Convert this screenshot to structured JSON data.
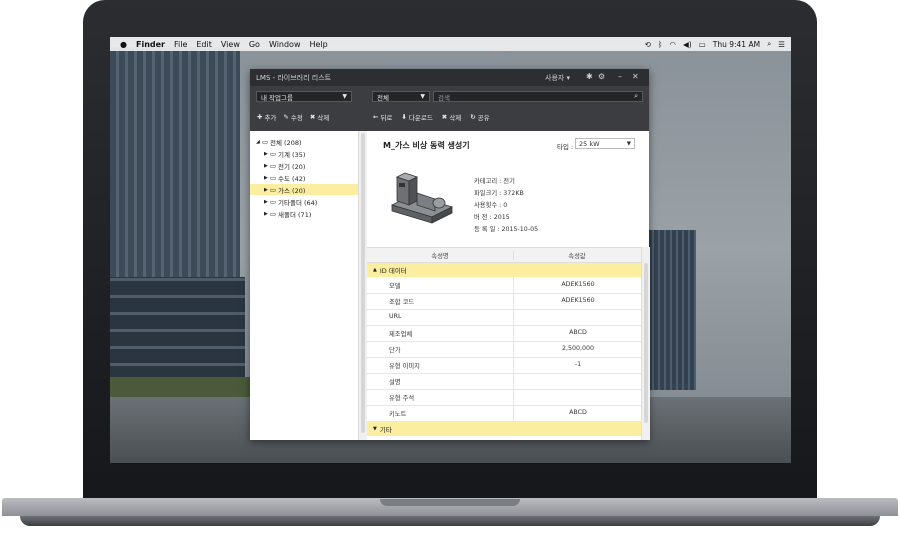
{
  "menubar": {
    "apple": "",
    "app": "Finder",
    "items": [
      "File",
      "Edit",
      "View",
      "Go",
      "Window",
      "Help"
    ],
    "clock": "Thu 9:41 AM"
  },
  "window": {
    "title": "LMS - 라이브러리 리스트",
    "user_menu": "사용자 ▾",
    "pin": "✱",
    "min": "–",
    "close": "✕"
  },
  "left_panel": {
    "group_select": "내 작업그룹",
    "actions": [
      {
        "icon": "plus-icon",
        "glyph": "✚",
        "label": "추가"
      },
      {
        "icon": "edit-icon",
        "glyph": "✎",
        "label": "수정"
      },
      {
        "icon": "delete-icon",
        "glyph": "✖",
        "label": "삭제"
      }
    ],
    "tree_root": "전체 (208)",
    "tree": [
      {
        "label": "기계 (35)"
      },
      {
        "label": "전기 (20)"
      },
      {
        "label": "수도 (42)"
      },
      {
        "label": "가스 (20)",
        "selected": true
      },
      {
        "label": "기타폴더 (64)"
      },
      {
        "label": "새폴더 (71)"
      }
    ]
  },
  "right_panel": {
    "filter_select": "전체",
    "search_placeholder": "검색",
    "actions": [
      {
        "icon": "back-icon",
        "glyph": "←",
        "label": "뒤로"
      },
      {
        "icon": "download-icon",
        "glyph": "⬇",
        "label": "다운로드"
      },
      {
        "icon": "delete-icon",
        "glyph": "✖",
        "label": "삭제"
      },
      {
        "icon": "share-icon",
        "glyph": "↻",
        "label": "공유"
      }
    ]
  },
  "detail": {
    "title": "M_가스 비상 동력 생성기",
    "type_label": "타입 :",
    "type_value": "25 kW",
    "meta": [
      "카테고리 : 전기",
      "파일크기 : 372KB",
      "사용횟수 : 0",
      "버       전 : 2015",
      "등  록  일 : 2015-10-05"
    ]
  },
  "properties": {
    "col_name": "속성명",
    "col_value": "속성값",
    "groups": [
      {
        "name": "ID 데이터",
        "rows": [
          {
            "k": "모델",
            "v": "ADEK1560"
          },
          {
            "k": "조합 코드",
            "v": "ADEK1560"
          },
          {
            "k": "URL",
            "v": ""
          },
          {
            "k": "제조업체",
            "v": "ABCD"
          },
          {
            "k": "단가",
            "v": "2,500,000"
          },
          {
            "k": "유형 이미지",
            "v": "-1"
          },
          {
            "k": "설명",
            "v": ""
          },
          {
            "k": "유형 주석",
            "v": ""
          },
          {
            "k": "키노트",
            "v": "ABCD"
          }
        ]
      },
      {
        "name": "기타",
        "rows": []
      }
    ]
  }
}
